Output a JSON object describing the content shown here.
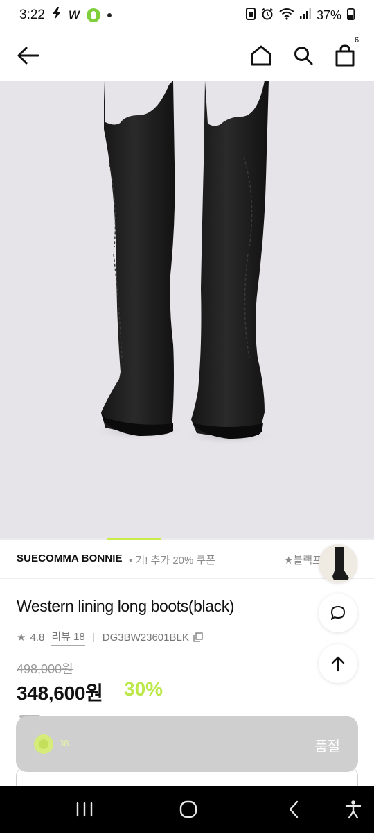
{
  "status_bar": {
    "time": "3:22",
    "w_label": "W",
    "battery": "37%"
  },
  "header": {
    "cart_count": "6"
  },
  "brand": {
    "name": "SUECOMMA BONNIE",
    "promo": "• 기! 추가 20% 쿠폰",
    "promo_secondary": "★블랙프"
  },
  "product": {
    "title": "Western lining long boots(black)",
    "rating": "4.8",
    "review_label": "리뷰 18",
    "code": "DG3BW23601BLK",
    "original_price": "498,000원",
    "sale_price": "348,600원",
    "discount": "30%"
  },
  "purchase_bar": {
    "like_count": "38",
    "status_label": "품절"
  },
  "colors": {
    "accent": "#bde84a",
    "hero_bg": "#e6e4e8",
    "bar_bg": "#cfcfcf"
  },
  "icons": [
    "back-arrow-icon",
    "home-icon",
    "search-icon",
    "shopping-bag-icon",
    "star-icon",
    "copy-icon",
    "chat-icon",
    "arrow-up-icon",
    "recents-icon",
    "home-circle-icon",
    "nav-back-icon",
    "accessibility-icon"
  ]
}
